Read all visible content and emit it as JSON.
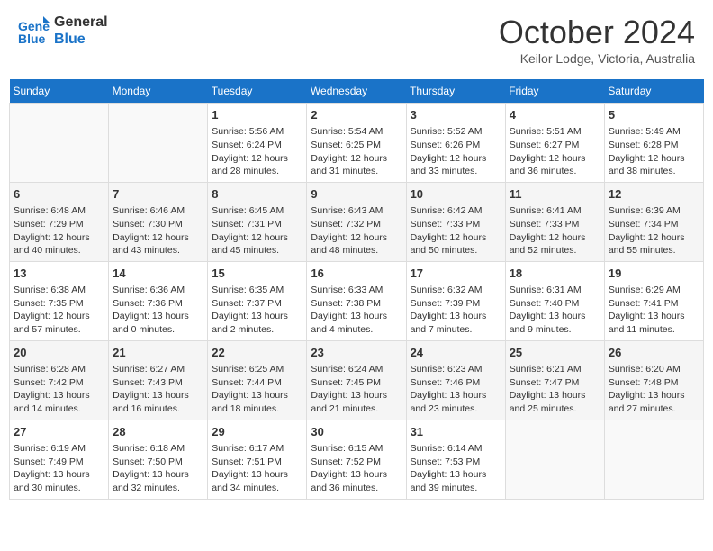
{
  "header": {
    "logo_line1": "General",
    "logo_line2": "Blue",
    "month": "October 2024",
    "location": "Keilor Lodge, Victoria, Australia"
  },
  "days_of_week": [
    "Sunday",
    "Monday",
    "Tuesday",
    "Wednesday",
    "Thursday",
    "Friday",
    "Saturday"
  ],
  "weeks": [
    [
      {
        "num": "",
        "info": ""
      },
      {
        "num": "",
        "info": ""
      },
      {
        "num": "1",
        "info": "Sunrise: 5:56 AM\nSunset: 6:24 PM\nDaylight: 12 hours and 28 minutes."
      },
      {
        "num": "2",
        "info": "Sunrise: 5:54 AM\nSunset: 6:25 PM\nDaylight: 12 hours and 31 minutes."
      },
      {
        "num": "3",
        "info": "Sunrise: 5:52 AM\nSunset: 6:26 PM\nDaylight: 12 hours and 33 minutes."
      },
      {
        "num": "4",
        "info": "Sunrise: 5:51 AM\nSunset: 6:27 PM\nDaylight: 12 hours and 36 minutes."
      },
      {
        "num": "5",
        "info": "Sunrise: 5:49 AM\nSunset: 6:28 PM\nDaylight: 12 hours and 38 minutes."
      }
    ],
    [
      {
        "num": "6",
        "info": "Sunrise: 6:48 AM\nSunset: 7:29 PM\nDaylight: 12 hours and 40 minutes."
      },
      {
        "num": "7",
        "info": "Sunrise: 6:46 AM\nSunset: 7:30 PM\nDaylight: 12 hours and 43 minutes."
      },
      {
        "num": "8",
        "info": "Sunrise: 6:45 AM\nSunset: 7:31 PM\nDaylight: 12 hours and 45 minutes."
      },
      {
        "num": "9",
        "info": "Sunrise: 6:43 AM\nSunset: 7:32 PM\nDaylight: 12 hours and 48 minutes."
      },
      {
        "num": "10",
        "info": "Sunrise: 6:42 AM\nSunset: 7:33 PM\nDaylight: 12 hours and 50 minutes."
      },
      {
        "num": "11",
        "info": "Sunrise: 6:41 AM\nSunset: 7:33 PM\nDaylight: 12 hours and 52 minutes."
      },
      {
        "num": "12",
        "info": "Sunrise: 6:39 AM\nSunset: 7:34 PM\nDaylight: 12 hours and 55 minutes."
      }
    ],
    [
      {
        "num": "13",
        "info": "Sunrise: 6:38 AM\nSunset: 7:35 PM\nDaylight: 12 hours and 57 minutes."
      },
      {
        "num": "14",
        "info": "Sunrise: 6:36 AM\nSunset: 7:36 PM\nDaylight: 13 hours and 0 minutes."
      },
      {
        "num": "15",
        "info": "Sunrise: 6:35 AM\nSunset: 7:37 PM\nDaylight: 13 hours and 2 minutes."
      },
      {
        "num": "16",
        "info": "Sunrise: 6:33 AM\nSunset: 7:38 PM\nDaylight: 13 hours and 4 minutes."
      },
      {
        "num": "17",
        "info": "Sunrise: 6:32 AM\nSunset: 7:39 PM\nDaylight: 13 hours and 7 minutes."
      },
      {
        "num": "18",
        "info": "Sunrise: 6:31 AM\nSunset: 7:40 PM\nDaylight: 13 hours and 9 minutes."
      },
      {
        "num": "19",
        "info": "Sunrise: 6:29 AM\nSunset: 7:41 PM\nDaylight: 13 hours and 11 minutes."
      }
    ],
    [
      {
        "num": "20",
        "info": "Sunrise: 6:28 AM\nSunset: 7:42 PM\nDaylight: 13 hours and 14 minutes."
      },
      {
        "num": "21",
        "info": "Sunrise: 6:27 AM\nSunset: 7:43 PM\nDaylight: 13 hours and 16 minutes."
      },
      {
        "num": "22",
        "info": "Sunrise: 6:25 AM\nSunset: 7:44 PM\nDaylight: 13 hours and 18 minutes."
      },
      {
        "num": "23",
        "info": "Sunrise: 6:24 AM\nSunset: 7:45 PM\nDaylight: 13 hours and 21 minutes."
      },
      {
        "num": "24",
        "info": "Sunrise: 6:23 AM\nSunset: 7:46 PM\nDaylight: 13 hours and 23 minutes."
      },
      {
        "num": "25",
        "info": "Sunrise: 6:21 AM\nSunset: 7:47 PM\nDaylight: 13 hours and 25 minutes."
      },
      {
        "num": "26",
        "info": "Sunrise: 6:20 AM\nSunset: 7:48 PM\nDaylight: 13 hours and 27 minutes."
      }
    ],
    [
      {
        "num": "27",
        "info": "Sunrise: 6:19 AM\nSunset: 7:49 PM\nDaylight: 13 hours and 30 minutes."
      },
      {
        "num": "28",
        "info": "Sunrise: 6:18 AM\nSunset: 7:50 PM\nDaylight: 13 hours and 32 minutes."
      },
      {
        "num": "29",
        "info": "Sunrise: 6:17 AM\nSunset: 7:51 PM\nDaylight: 13 hours and 34 minutes."
      },
      {
        "num": "30",
        "info": "Sunrise: 6:15 AM\nSunset: 7:52 PM\nDaylight: 13 hours and 36 minutes."
      },
      {
        "num": "31",
        "info": "Sunrise: 6:14 AM\nSunset: 7:53 PM\nDaylight: 13 hours and 39 minutes."
      },
      {
        "num": "",
        "info": ""
      },
      {
        "num": "",
        "info": ""
      }
    ]
  ]
}
